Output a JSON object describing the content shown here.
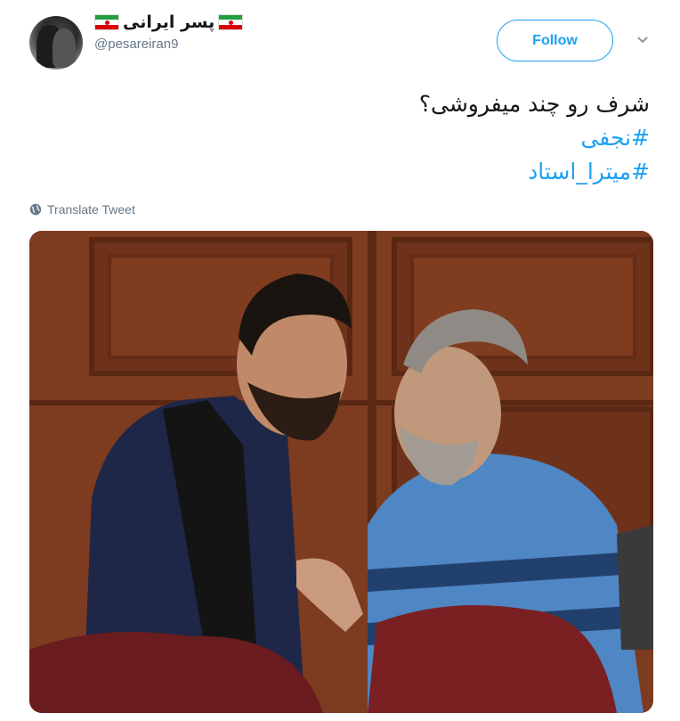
{
  "user": {
    "display_name": "پسر ایرانی",
    "handle": "@pesareiran9",
    "flag_icon": "iran-flag-icon"
  },
  "actions": {
    "follow_label": "Follow",
    "more_icon": "chevron-down-icon"
  },
  "tweet": {
    "text": "شرف رو چند میفروشی؟",
    "hashtags": [
      "#نجفی",
      "#میترا_استاد"
    ]
  },
  "translate": {
    "label": "Translate Tweet",
    "icon": "globe-icon"
  },
  "colors": {
    "accent": "#1da1f2",
    "muted": "#657786",
    "text": "#14171a"
  }
}
